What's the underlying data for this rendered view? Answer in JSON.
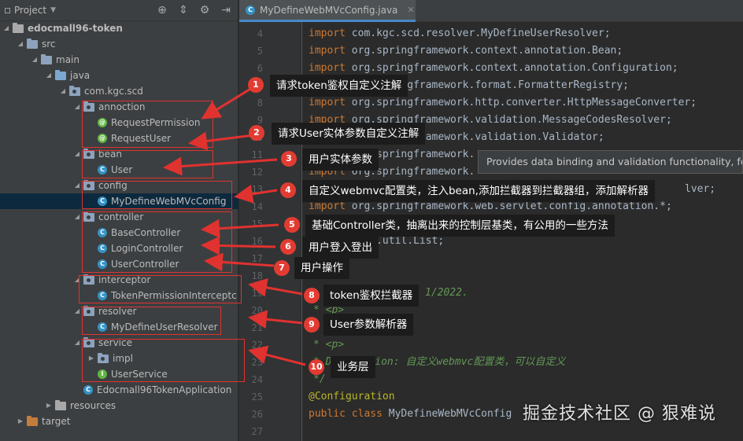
{
  "panel": {
    "title": "Project",
    "tools": [
      "crosshair-icon",
      "collapse-icon",
      "gear-icon",
      "hide-icon"
    ]
  },
  "tree": [
    {
      "label": "edocmall96-token",
      "icon": "project"
    },
    {
      "label": "src",
      "icon": "folder"
    },
    {
      "label": "main",
      "icon": "folder"
    },
    {
      "label": "java",
      "icon": "source-folder"
    },
    {
      "label": "com.kgc.scd",
      "icon": "package"
    },
    {
      "label": "annoction",
      "icon": "package"
    },
    {
      "label": "RequestPermission",
      "icon": "annotation"
    },
    {
      "label": "RequestUser",
      "icon": "annotation"
    },
    {
      "label": "bean",
      "icon": "package"
    },
    {
      "label": "User",
      "icon": "class"
    },
    {
      "label": "config",
      "icon": "package"
    },
    {
      "label": "MyDefineWebMVcConfig",
      "icon": "class"
    },
    {
      "label": "controller",
      "icon": "package"
    },
    {
      "label": "BaseController",
      "icon": "class"
    },
    {
      "label": "LoginController",
      "icon": "class"
    },
    {
      "label": "UserController",
      "icon": "class"
    },
    {
      "label": "interceptor",
      "icon": "package"
    },
    {
      "label": "TokenPermissionInterceptc",
      "icon": "class"
    },
    {
      "label": "resolver",
      "icon": "package"
    },
    {
      "label": "MyDefineUserResolver",
      "icon": "class"
    },
    {
      "label": "service",
      "icon": "package"
    },
    {
      "label": "impl",
      "icon": "package"
    },
    {
      "label": "UserService",
      "icon": "interface"
    },
    {
      "label": "Edocmall96TokenApplication",
      "icon": "class"
    },
    {
      "label": "resources",
      "icon": "resources-folder"
    },
    {
      "label": "target",
      "icon": "target-folder"
    }
  ],
  "editor": {
    "tab_label": "MyDefineWebMVcConfig.java",
    "line_numbers": [
      "4",
      "5",
      "6",
      "7",
      "8",
      "9",
      "10",
      "11",
      "12",
      "13",
      "14",
      "15",
      "16",
      "17",
      "18",
      "19",
      "20",
      "21",
      "22",
      "23",
      "24",
      "25",
      "26",
      "27"
    ],
    "imports": [
      {
        "kw": "import",
        "rest": "com.kgc.scd.resolver.MyDefineUserResolver;"
      },
      {
        "kw": "import",
        "rest": "org.springframework.context.annotation.Bean;"
      },
      {
        "kw": "import",
        "rest": "org.springframework.context.annotation.Configuration;"
      },
      {
        "kw": "import",
        "rest": "org.springframework.format.FormatterRegistry;"
      },
      {
        "kw": "import",
        "rest": "org.springframework.http.converter.HttpMessageConverter;"
      },
      {
        "kw": "import",
        "rest": "org.springframework.validation.MessageCodesResolver;"
      },
      {
        "kw": "import",
        "rest": "org.springframework.validation.Validator;"
      },
      {
        "kw": "import",
        "rest": "org.springframework."
      },
      {
        "kw": "import",
        "rest": "org.springframework."
      },
      {
        "kw": "import",
        "rest": "org.springframework.web.servlet.config.annotation.*;"
      },
      {
        "kw": "import",
        "rest": "java.util.List;"
      }
    ],
    "partial_lines": {
      "resolver_tail": "lver;",
      "date_comment": "1/2022.",
      "p_tag_1": "* <p>",
      "p_tag_2": "* <p>",
      "description": "* Description: 自定义webmvc配置类，可以自定义",
      "comment_end": "*/",
      "annotation": "@Configuration",
      "class_kw": "public class",
      "class_name": "MyDefineWebMVcConfig"
    },
    "tooltip": "Provides data binding and validation functionality, fo"
  },
  "callouts": [
    {
      "num": "1",
      "text": "请求token鉴权自定义注解"
    },
    {
      "num": "2",
      "text": "请求User实体参数自定义注解"
    },
    {
      "num": "3",
      "text": "用户实体参数"
    },
    {
      "num": "4",
      "text": "自定义webmvc配置类，注入bean,添加拦截器到拦截器组，添加解析器"
    },
    {
      "num": "5",
      "text": "基础Controller类，抽离出来的控制层基类，有公用的一些方法"
    },
    {
      "num": "6",
      "text": "用户登入登出"
    },
    {
      "num": "7",
      "text": "用户操作"
    },
    {
      "num": "8",
      "text": "token鉴权拦截器"
    },
    {
      "num": "9",
      "text": "User参数解析器"
    },
    {
      "num": "10",
      "text": "业务层"
    }
  ],
  "watermark": "掘金技术社区 @ 狠难说",
  "colors": {
    "annotation_red": "#e0322f",
    "badge_red": "#e23c32",
    "panel_bg": "#3c3f41",
    "editor_bg": "#2b2b2b",
    "keyword": "#cc7832",
    "selection": "#0d293e"
  }
}
